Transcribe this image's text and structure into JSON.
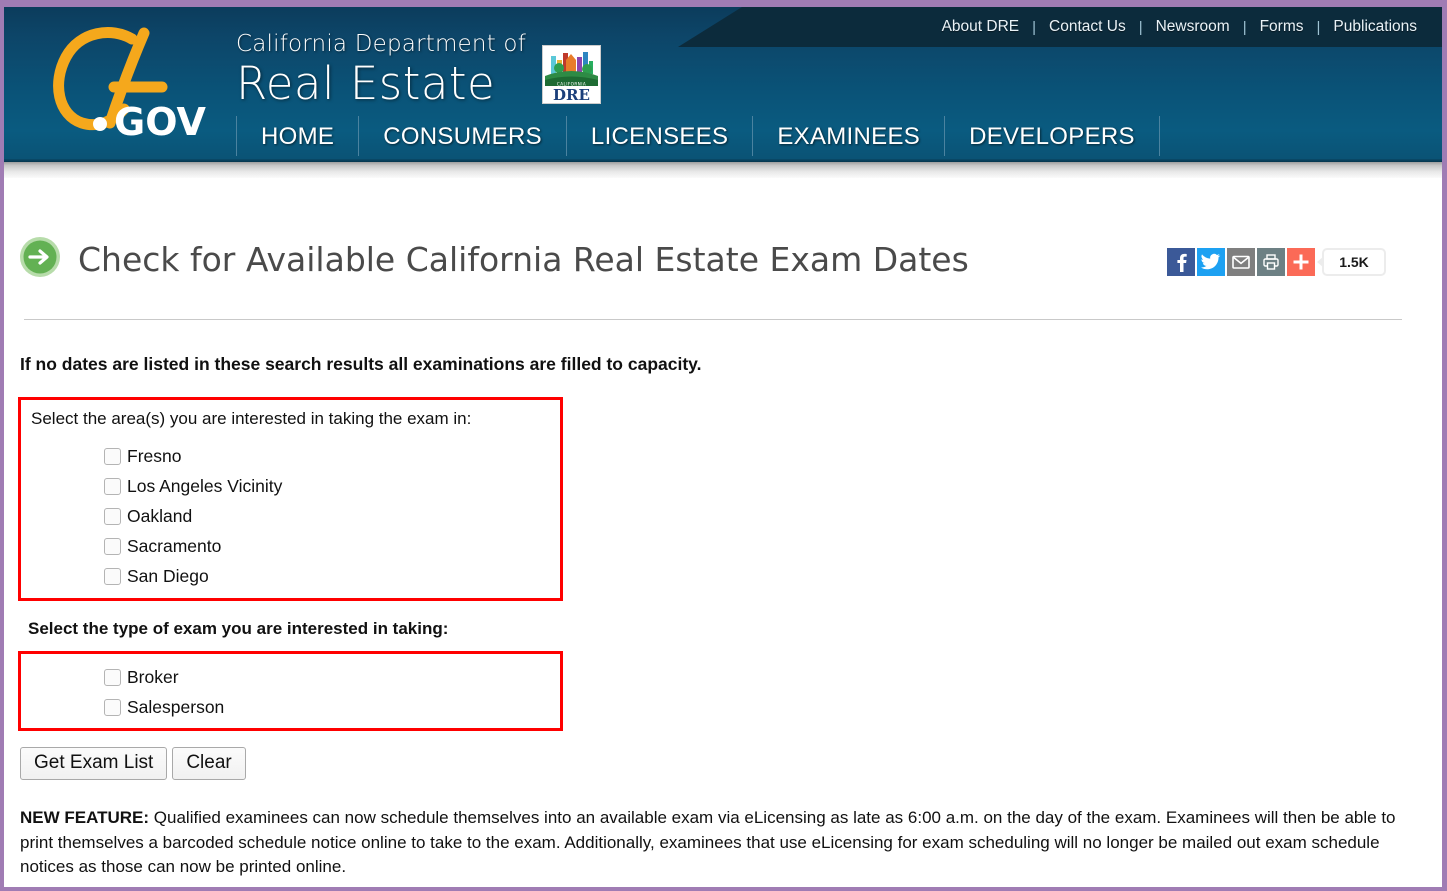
{
  "colors": {
    "frame": "#a07cb4",
    "header_blue": "#0a5378",
    "utility_dark": "#0c2b3c",
    "accent_red": "#ff0000",
    "logo_gold": "#f5a81c",
    "arrow_green": "#7cbf6c"
  },
  "header": {
    "logo_alt": "CA.GOV",
    "agency_line1": "California Department of",
    "agency_line2": "Real Estate",
    "badge_state": "CALIFORNIA",
    "badge_text": "DRE",
    "utility_nav": [
      {
        "label": "About DRE"
      },
      {
        "label": "Contact Us"
      },
      {
        "label": "Newsroom"
      },
      {
        "label": "Forms"
      },
      {
        "label": "Publications"
      }
    ],
    "utility_separator": "|",
    "main_nav": [
      {
        "label": "HOME"
      },
      {
        "label": "CONSUMERS"
      },
      {
        "label": "LICENSEES"
      },
      {
        "label": "EXAMINEES"
      },
      {
        "label": "DEVELOPERS"
      }
    ]
  },
  "page": {
    "title": "Check for Available California Real Estate Exam Dates",
    "notice": "If no dates are listed in these search results all examinations are filled to capacity."
  },
  "share": {
    "facebook_label": "f",
    "twitter_label": "twitter-bird",
    "email_label": "envelope",
    "print_label": "printer",
    "addthis_label": "+",
    "count": "1.5K"
  },
  "form": {
    "areas_legend": "Select the area(s) you are interested in taking the exam in:",
    "areas": [
      {
        "label": "Fresno",
        "checked": false
      },
      {
        "label": "Los Angeles Vicinity",
        "checked": false
      },
      {
        "label": "Oakland",
        "checked": false
      },
      {
        "label": "Sacramento",
        "checked": false
      },
      {
        "label": "San Diego",
        "checked": false
      }
    ],
    "types_legend": "Select the type of exam you are interested in taking:",
    "types": [
      {
        "label": "Broker",
        "checked": false
      },
      {
        "label": "Salesperson",
        "checked": false
      }
    ],
    "submit_label": "Get Exam List",
    "clear_label": "Clear"
  },
  "footnote": {
    "lead": "NEW FEATURE:",
    "body": " Qualified examinees can now schedule themselves into an available exam via eLicensing as late as 6:00 a.m. on the day of the exam. Examinees will then be able to print themselves a barcoded schedule notice online to take to the exam. Additionally, examinees that use eLicensing for exam scheduling will no longer be mailed out exam schedule notices as those can now be printed online."
  }
}
